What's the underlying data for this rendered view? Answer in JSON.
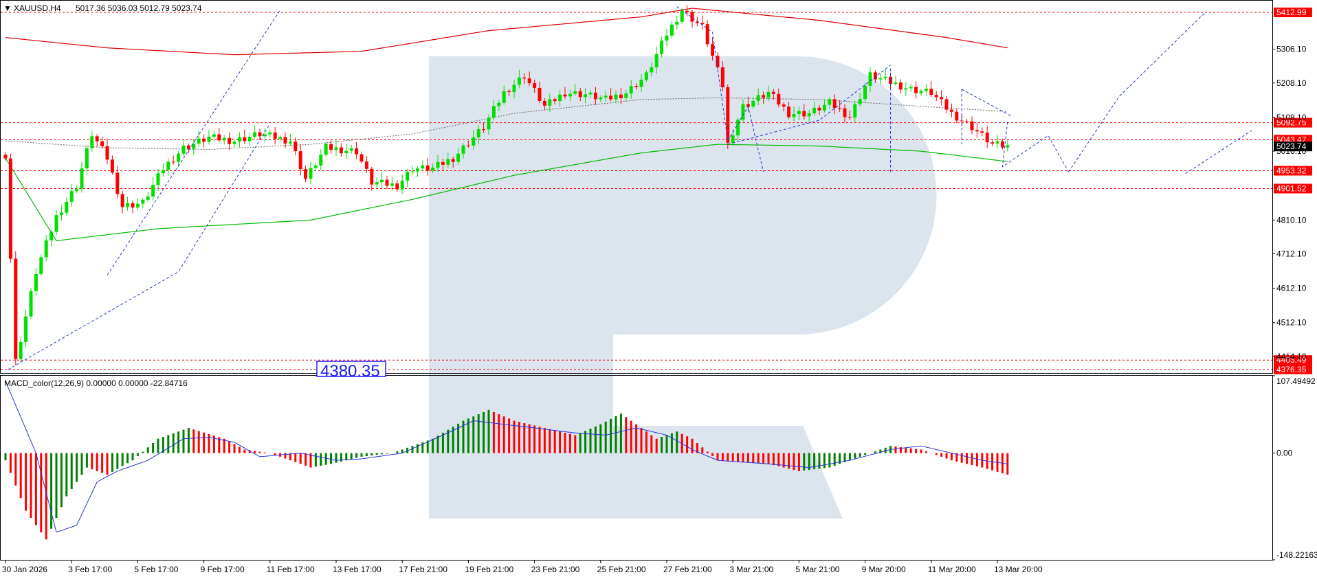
{
  "header": {
    "symbol": "XAUUSD,H4",
    "ohlc": "5017.36 5036.03 5012.79 5023.74"
  },
  "macd_header": "MACD_color(12,26,9) 0.00000 0.00000 -22.84716",
  "colors": {
    "bull": "#00e000",
    "bear": "#ff0000",
    "level_line": "#ff0000",
    "level_label_bg": "#ff0000",
    "forecast": "#2233dd",
    "ma_slow": "#dd0000",
    "ma_mid": "#00bb00",
    "ma_dotted": "#666666",
    "macd_signal": "#2233dd",
    "watermark": "#d6dfeb"
  },
  "chart_data": {
    "type": "candlestick",
    "price_axis": {
      "range": [
        4366,
        5447
      ],
      "ticks": [
        "5306.10",
        "5208.10",
        "5108.10",
        "5010.10",
        "4810.10",
        "4712.10",
        "4612.10",
        "4512.10",
        "4414.10"
      ],
      "current": "5023.74"
    },
    "levels": [
      {
        "value": 5412.99,
        "label": "5412.99"
      },
      {
        "value": 5092.75,
        "label": "5092.75"
      },
      {
        "value": 5043.47,
        "label": "5043.47"
      },
      {
        "value": 4953.32,
        "label": "4953.32"
      },
      {
        "value": 4901.52,
        "label": "4901.52"
      },
      {
        "value": 4403.49,
        "label": "4403.49"
      },
      {
        "value": 4376.35,
        "label": "4376.35"
      }
    ],
    "price_box": "4380.35",
    "x_labels": [
      "30 Jan 2026",
      "3 Feb 17:00",
      "5 Feb 17:00",
      "9 Feb 17:00",
      "11 Feb 17:00",
      "13 Feb 17:00",
      "17 Feb 21:00",
      "19 Feb 21:00",
      "23 Feb 21:00",
      "25 Feb 21:00",
      "27 Feb 21:00",
      "3 Mar 21:00",
      "5 Mar 21:00",
      "9 Mar 20:00",
      "11 Mar 20:00",
      "13 Mar 20:00"
    ],
    "x_label_index": [
      0,
      13,
      26,
      39,
      52,
      65,
      78,
      91,
      104,
      117,
      130,
      143,
      156,
      169,
      182,
      195
    ],
    "ohlc_anchors": [
      [
        0,
        5000
      ],
      [
        2,
        4400
      ],
      [
        6,
        4660
      ],
      [
        10,
        4820
      ],
      [
        14,
        4910
      ],
      [
        17,
        5060
      ],
      [
        20,
        4990
      ],
      [
        23,
        4850
      ],
      [
        27,
        4860
      ],
      [
        31,
        4960
      ],
      [
        35,
        5020
      ],
      [
        40,
        5050
      ],
      [
        45,
        5040
      ],
      [
        50,
        5060
      ],
      [
        56,
        5040
      ],
      [
        59,
        4930
      ],
      [
        63,
        5020
      ],
      [
        69,
        5010
      ],
      [
        72,
        4920
      ],
      [
        77,
        4910
      ],
      [
        80,
        4960
      ],
      [
        84,
        4960
      ],
      [
        88,
        4990
      ],
      [
        94,
        5080
      ],
      [
        98,
        5180
      ],
      [
        102,
        5230
      ],
      [
        106,
        5140
      ],
      [
        110,
        5180
      ],
      [
        114,
        5175
      ],
      [
        118,
        5160
      ],
      [
        122,
        5180
      ],
      [
        126,
        5230
      ],
      [
        130,
        5350
      ],
      [
        133,
        5420
      ],
      [
        137,
        5370
      ],
      [
        141,
        5200
      ],
      [
        142,
        5030
      ],
      [
        145,
        5140
      ],
      [
        150,
        5180
      ],
      [
        154,
        5120
      ],
      [
        158,
        5120
      ],
      [
        162,
        5150
      ],
      [
        166,
        5110
      ],
      [
        170,
        5230
      ],
      [
        174,
        5210
      ],
      [
        178,
        5190
      ],
      [
        182,
        5180
      ],
      [
        186,
        5120
      ],
      [
        190,
        5080
      ],
      [
        194,
        5030
      ],
      [
        197,
        5023
      ]
    ],
    "ma_slow": [
      [
        0,
        5340
      ],
      [
        20,
        5310
      ],
      [
        45,
        5290
      ],
      [
        70,
        5300
      ],
      [
        95,
        5360
      ],
      [
        125,
        5400
      ],
      [
        135,
        5425
      ],
      [
        160,
        5390
      ],
      [
        185,
        5340
      ],
      [
        197,
        5310
      ]
    ],
    "ma_mid": [
      [
        0,
        4990
      ],
      [
        10,
        4750
      ],
      [
        30,
        4785
      ],
      [
        60,
        4810
      ],
      [
        80,
        4870
      ],
      [
        100,
        4940
      ],
      [
        125,
        5005
      ],
      [
        140,
        5030
      ],
      [
        160,
        5025
      ],
      [
        180,
        5010
      ],
      [
        197,
        4980
      ]
    ],
    "ma_dotted": [
      [
        0,
        5040
      ],
      [
        20,
        5020
      ],
      [
        40,
        5015
      ],
      [
        60,
        5030
      ],
      [
        80,
        5060
      ],
      [
        100,
        5120
      ],
      [
        125,
        5160
      ],
      [
        140,
        5165
      ],
      [
        160,
        5160
      ],
      [
        180,
        5140
      ],
      [
        197,
        5125
      ]
    ],
    "forecast": [
      [
        [
          0.5,
          4376
        ],
        [
          34,
          4660
        ],
        [
          52,
          5090
        ]
      ],
      [
        [
          20,
          4650
        ],
        [
          54,
          5420
        ]
      ],
      [
        [
          132,
          5430
        ],
        [
          139,
          5355
        ],
        [
          140,
          5250
        ],
        [
          142,
          5040
        ],
        [
          146,
          5140
        ],
        [
          149,
          4950
        ]
      ],
      [
        [
          142,
          5030
        ],
        [
          160,
          5100
        ],
        [
          174,
          5260
        ]
      ],
      [
        [
          174,
          5250
        ],
        [
          174,
          4950
        ]
      ],
      [
        [
          188,
          5190
        ],
        [
          188,
          5030
        ]
      ],
      [
        [
          188,
          5190
        ],
        [
          198,
          5110
        ]
      ],
      [
        [
          197,
          5095
        ],
        [
          196,
          4965
        ],
        [
          205,
          5055
        ],
        [
          209,
          4950
        ]
      ],
      [
        [
          209,
          4950
        ],
        [
          219,
          5170
        ],
        [
          236,
          5415
        ]
      ],
      [
        [
          232,
          4945
        ],
        [
          245,
          5070
        ]
      ]
    ],
    "macd": {
      "axis": [
        "107.49492",
        "0.00",
        "-148.22163"
      ],
      "range": [
        -148.22163,
        107.49492
      ],
      "anchors": [
        [
          0,
          -10
        ],
        [
          4,
          -80
        ],
        [
          8,
          -120
        ],
        [
          12,
          -60
        ],
        [
          16,
          -20
        ],
        [
          20,
          -30
        ],
        [
          25,
          -10
        ],
        [
          30,
          20
        ],
        [
          36,
          35
        ],
        [
          43,
          20
        ],
        [
          47,
          5
        ],
        [
          52,
          0
        ],
        [
          56,
          -10
        ],
        [
          60,
          -20
        ],
        [
          64,
          -15
        ],
        [
          70,
          -5
        ],
        [
          76,
          0
        ],
        [
          84,
          20
        ],
        [
          90,
          45
        ],
        [
          95,
          60
        ],
        [
          100,
          45
        ],
        [
          106,
          35
        ],
        [
          112,
          25
        ],
        [
          117,
          40
        ],
        [
          121,
          55
        ],
        [
          124,
          40
        ],
        [
          128,
          20
        ],
        [
          132,
          30
        ],
        [
          135,
          20
        ],
        [
          140,
          -10
        ],
        [
          150,
          -15
        ],
        [
          156,
          -25
        ],
        [
          162,
          -20
        ],
        [
          168,
          -5
        ],
        [
          174,
          10
        ],
        [
          180,
          5
        ],
        [
          186,
          -10
        ],
        [
          192,
          -20
        ],
        [
          197,
          -30
        ]
      ],
      "signal": [
        [
          0,
          100
        ],
        [
          6,
          0
        ],
        [
          10,
          -110
        ],
        [
          14,
          -100
        ],
        [
          18,
          -40
        ],
        [
          22,
          -25
        ],
        [
          28,
          -10
        ],
        [
          35,
          20
        ],
        [
          40,
          22
        ],
        [
          45,
          15
        ],
        [
          50,
          -5
        ],
        [
          58,
          0
        ],
        [
          65,
          -10
        ],
        [
          70,
          -8
        ],
        [
          78,
          0
        ],
        [
          86,
          25
        ],
        [
          92,
          45
        ],
        [
          98,
          40
        ],
        [
          104,
          35
        ],
        [
          112,
          28
        ],
        [
          118,
          25
        ],
        [
          124,
          35
        ],
        [
          130,
          25
        ],
        [
          135,
          5
        ],
        [
          140,
          -10
        ],
        [
          150,
          -15
        ],
        [
          158,
          -20
        ],
        [
          166,
          -10
        ],
        [
          174,
          5
        ],
        [
          180,
          10
        ],
        [
          186,
          0
        ],
        [
          192,
          -10
        ],
        [
          197,
          -15
        ]
      ]
    }
  }
}
